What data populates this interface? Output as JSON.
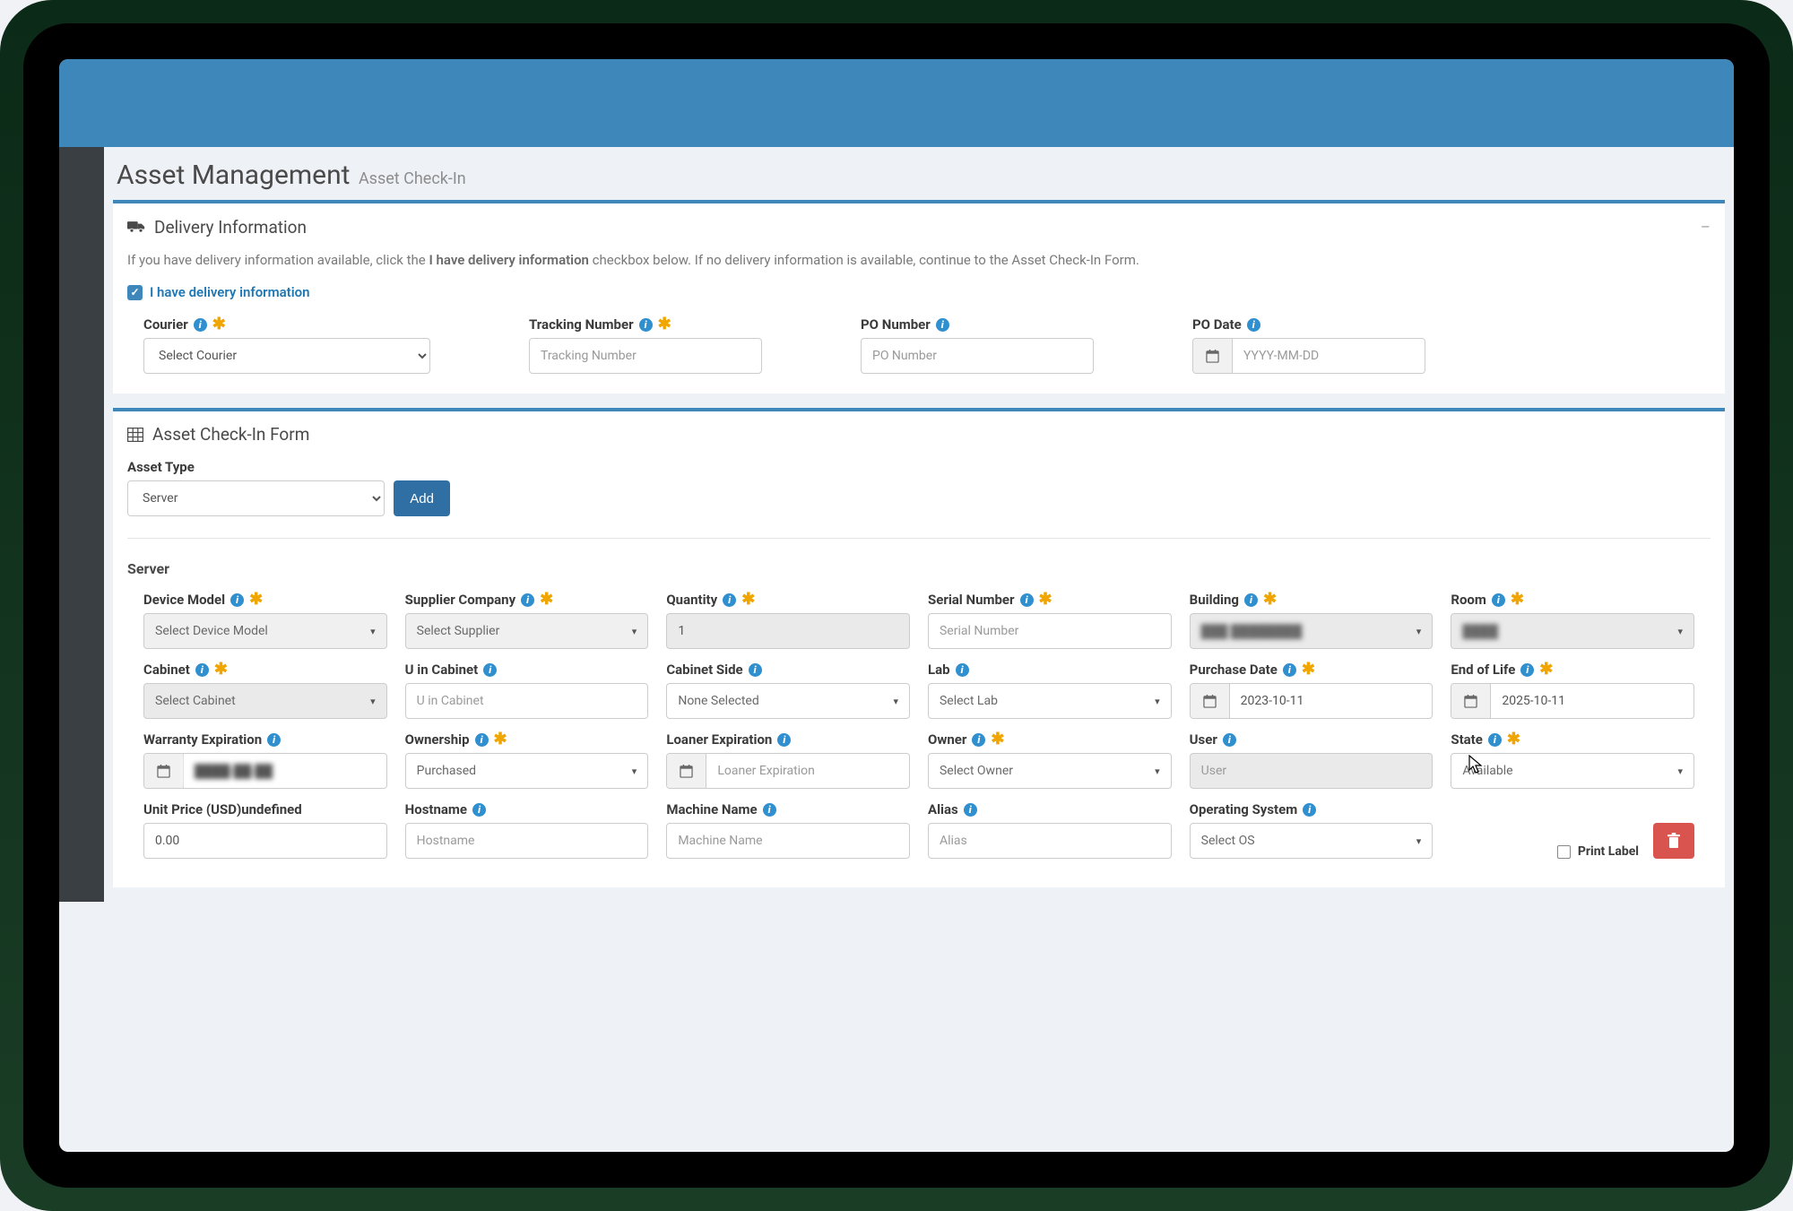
{
  "page": {
    "title": "Asset Management",
    "subtitle": "Asset Check-In"
  },
  "delivery_panel": {
    "title": "Delivery Information",
    "help_prefix": "If you have delivery information available, click the ",
    "help_bold": "I have delivery information",
    "help_suffix": " checkbox below. If no delivery information is available, continue to the Asset Check-In Form.",
    "checkbox_label": "I have delivery information",
    "courier": {
      "label": "Courier",
      "placeholder": "Select Courier"
    },
    "tracking": {
      "label": "Tracking Number",
      "placeholder": "Tracking Number"
    },
    "po_number": {
      "label": "PO Number",
      "placeholder": "PO Number"
    },
    "po_date": {
      "label": "PO Date",
      "placeholder": "YYYY-MM-DD"
    }
  },
  "checkin_panel": {
    "title": "Asset Check-In Form",
    "asset_type": {
      "label": "Asset Type",
      "value": "Server",
      "add": "Add"
    },
    "section_label": "Server",
    "fields": {
      "device_model": {
        "label": "Device Model",
        "placeholder": "Select Device Model"
      },
      "supplier": {
        "label": "Supplier Company",
        "placeholder": "Select Supplier"
      },
      "quantity": {
        "label": "Quantity",
        "value": "1"
      },
      "serial": {
        "label": "Serial Number",
        "placeholder": "Serial Number"
      },
      "building": {
        "label": "Building",
        "value": "███ ████████"
      },
      "room": {
        "label": "Room",
        "value": "████"
      },
      "cabinet": {
        "label": "Cabinet",
        "placeholder": "Select Cabinet"
      },
      "u_in_cabinet": {
        "label": "U in Cabinet",
        "placeholder": "U in Cabinet"
      },
      "cabinet_side": {
        "label": "Cabinet Side",
        "placeholder": "None Selected"
      },
      "lab": {
        "label": "Lab",
        "placeholder": "Select Lab"
      },
      "purchase_date": {
        "label": "Purchase Date",
        "value": "2023-10-11"
      },
      "end_of_life": {
        "label": "End of Life",
        "value": "2025-10-11"
      },
      "warranty": {
        "label": "Warranty Expiration",
        "value": "████-██-██"
      },
      "ownership": {
        "label": "Ownership",
        "placeholder": "Purchased"
      },
      "loaner_exp": {
        "label": "Loaner Expiration",
        "placeholder": "Loaner Expiration"
      },
      "owner": {
        "label": "Owner",
        "placeholder": "Select Owner"
      },
      "user": {
        "label": "User",
        "placeholder": "User"
      },
      "state": {
        "label": "State",
        "placeholder": "Available"
      },
      "unit_price": {
        "label": "Unit Price (USD)undefined",
        "value": "0.00"
      },
      "hostname": {
        "label": "Hostname",
        "placeholder": "Hostname"
      },
      "machine_name": {
        "label": "Machine Name",
        "placeholder": "Machine Name"
      },
      "alias": {
        "label": "Alias",
        "placeholder": "Alias"
      },
      "os": {
        "label": "Operating System",
        "placeholder": "Select OS"
      },
      "print_label": "Print Label"
    }
  }
}
